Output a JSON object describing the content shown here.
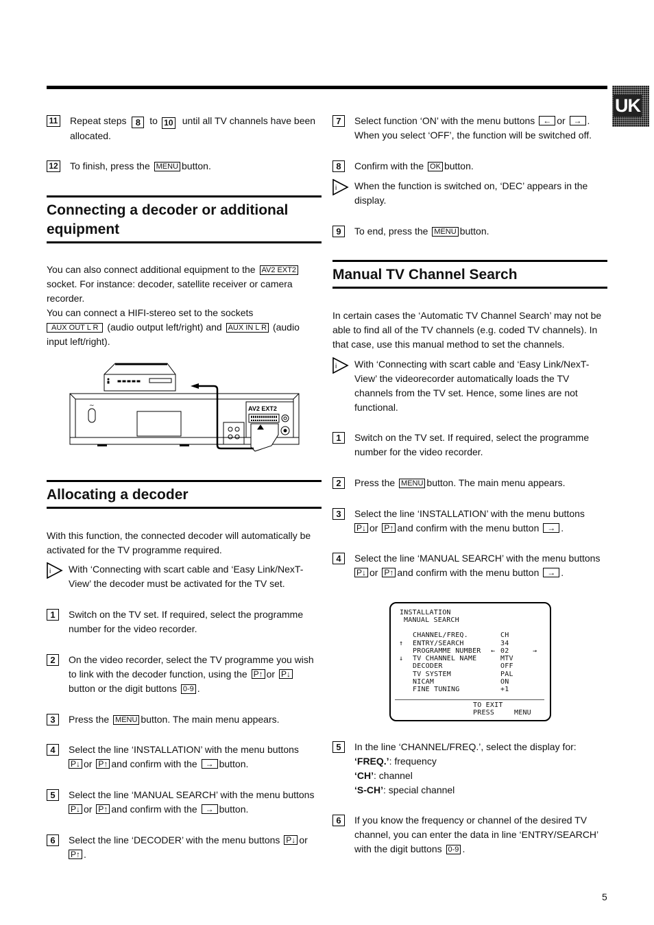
{
  "lang_tab": "UK",
  "page_number": "5",
  "left": {
    "steps_top": [
      {
        "num": "11",
        "pre": "Repeat steps",
        "ref1": "8",
        "mid": "to",
        "ref2": "10",
        "post": "until all TV channels have been allocated."
      },
      {
        "num": "12",
        "pre": "To finish, press the",
        "key": "MENU",
        "post": "button."
      }
    ],
    "connecting": {
      "title": "Connecting a decoder or additional equipment",
      "p1_pre": "You can also connect additional equipment to the",
      "p1_key": "AV2 EXT2",
      "p1_post": "socket. For instance: decoder, satellite receiver or camera recorder.",
      "p2_pre": "You can connect a HIFI-stereo set to the sockets",
      "p2_key1": "AUX OUT L R",
      "p2_mid": "(audio output left/right) and",
      "p2_key2": "AUX IN L R",
      "p2_post": "(audio input left/right).",
      "diagram_label": "AV2  EXT2"
    },
    "allocating": {
      "title": "Allocating a decoder",
      "intro": "With this function, the connected decoder will automatically be activated for the TV programme required.",
      "info": "With ‘Connecting with scart cable and ‘Easy Link/NexT-View’ the decoder must be activated for the TV set.",
      "steps": [
        {
          "num": "1",
          "text": "Switch on the TV set. If required, select the programme number for the video recorder."
        },
        {
          "num": "2",
          "pre": "On the video recorder, select the TV programme you wish to link with the decoder function, using the",
          "key1": "P↑",
          "mid": "or",
          "key2": "P↓",
          "mid2": "button or the digit buttons",
          "key3": "0-9",
          "post": "."
        },
        {
          "num": "3",
          "pre": "Press the",
          "key": "MENU",
          "post": "button. The main menu appears."
        },
        {
          "num": "4",
          "pre": "Select the line ‘INSTALLATION’ with the menu buttons",
          "key1": "P↓",
          "mid": "or",
          "key2": "P↑",
          "mid2": "and confirm with the",
          "key3": "→",
          "post": "button."
        },
        {
          "num": "5",
          "pre": "Select the line ‘MANUAL SEARCH’ with the menu buttons",
          "key1": "P↓",
          "mid": "or",
          "key2": "P↑",
          "mid2": "and confirm with the",
          "key3": "→",
          "post": "button."
        },
        {
          "num": "6",
          "pre": "Select the line ‘DECODER’ with the menu buttons",
          "key1": "P↓",
          "mid": "or",
          "key2": "P↑",
          "post": "."
        }
      ]
    }
  },
  "right": {
    "steps_top": [
      {
        "num": "7",
        "pre": "Select function ‘ON’ with the menu buttons",
        "key1": "←",
        "mid": "or",
        "key2": "→",
        "post": ". When you select ‘OFF’, the function will be switched off."
      },
      {
        "num": "8",
        "pre": "Confirm with the",
        "key": "OK",
        "post": "button."
      },
      {
        "info": "When the function is switched on, ‘DEC’ appears in the display."
      },
      {
        "num": "9",
        "pre": "To end, press the",
        "key": "MENU",
        "post": "button."
      }
    ],
    "manual": {
      "title": "Manual TV Channel Search",
      "intro": "In certain cases the ‘Automatic TV Channel Search’ may not be able to find all of the TV channels (e.g. coded TV channels). In that case, use this manual method to set the channels.",
      "info": "With ‘Connecting with scart cable and ‘Easy Link/NexT-View’ the videorecorder automatically loads the TV channels from the TV set. Hence, some lines are not functional.",
      "steps": [
        {
          "num": "1",
          "text": "Switch on the TV set. If required, select the programme number for the video recorder."
        },
        {
          "num": "2",
          "pre": "Press the",
          "key": "MENU",
          "post": "button. The main menu appears."
        },
        {
          "num": "3",
          "pre": "Select the line ‘INSTALLATION’ with the menu buttons",
          "key1": "P↓",
          "mid": "or",
          "key2": "P↑",
          "mid2": "and confirm with the menu button",
          "key3": "→",
          "post": "."
        },
        {
          "num": "4",
          "pre": "Select the line ‘MANUAL SEARCH’ with the menu buttons",
          "key1": "P↓",
          "mid": "or",
          "key2": "P↑",
          "mid2": "and confirm with the menu button",
          "key3": "→",
          "post": "."
        },
        {
          "num": "5",
          "line1": "In the line ‘CHANNEL/FREQ.’, select the display for:",
          "opts": [
            {
              "k": "‘FREQ.’",
              "v": ": frequency"
            },
            {
              "k": "‘CH’",
              "v": ": channel"
            },
            {
              "k": "‘S-CH’",
              "v": ": special channel"
            }
          ]
        },
        {
          "num": "6",
          "pre": "If you know the frequency or channel of the desired TV channel, you can enter the data in line ‘ENTRY/SEARCH’ with the digit buttons",
          "key": "0-9",
          "post": "."
        }
      ]
    },
    "osd": {
      "title1": "INSTALLATION",
      "title2": "MANUAL SEARCH",
      "rows": [
        {
          "label": "CHANNEL/FREQ.",
          "value": "CH"
        },
        {
          "label": "ENTRY/SEARCH",
          "value": "34"
        },
        {
          "label": "PROGRAMME NUMBER",
          "value": "02"
        },
        {
          "label": "TV CHANNEL NAME",
          "value": "MTV"
        },
        {
          "label": "DECODER",
          "value": "OFF"
        },
        {
          "label": "TV SYSTEM",
          "value": "PAL"
        },
        {
          "label": "NICAM",
          "value": "ON"
        },
        {
          "label": "FINE TUNING",
          "value": "+1"
        }
      ],
      "up_arrow": "↑",
      "down_arrow": "↓",
      "left_arrow": "←",
      "right_arrow": "→",
      "footer1": "TO EXIT",
      "footer2": "PRESS",
      "footer_key": "MENU"
    }
  }
}
